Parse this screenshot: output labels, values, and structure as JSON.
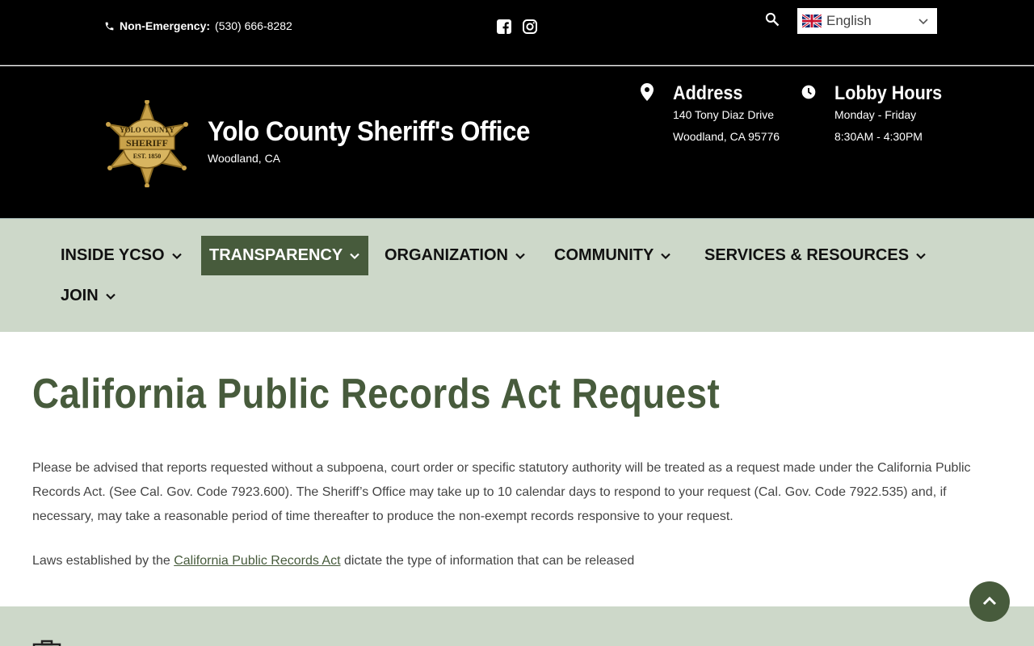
{
  "topbar": {
    "phone_label": "Non-Emergency:",
    "phone_number": "(530) 666-8282",
    "language": "English"
  },
  "header": {
    "title": "Yolo County Sheriff's Office",
    "subtitle": "Woodland, CA",
    "address_title": "Address",
    "address_line1": "140 Tony Diaz Drive",
    "address_line2": "Woodland, CA 95776",
    "hours_title": "Lobby Hours",
    "hours_line1": "Monday - Friday",
    "hours_line2": "8:30AM - 4:30PM",
    "badge_text_top": "YOLO COUNTY",
    "badge_text_mid": "SHERIFF",
    "badge_text_bot": "EST. 1850"
  },
  "nav": {
    "items": [
      {
        "label": "INSIDE YCSO"
      },
      {
        "label": "TRANSPARENCY"
      },
      {
        "label": "ORGANIZATION"
      },
      {
        "label": "COMMUNITY"
      },
      {
        "label": "SERVICES & RESOURCES"
      },
      {
        "label": "JOIN"
      }
    ]
  },
  "main": {
    "title": "California Public Records Act Request",
    "para1": "Please be advised that reports requested without a subpoena, court order or specific statutory authority will be treated as a request made under the California Public Records Act. (See Cal. Gov. Code 7923.600).  The Sheriff’s Office may take up to 10 calendar days to respond to your request (Cal. Gov. Code 7922.535) and, if necessary, may take a reasonable period of time thereafter to produce the non-exempt records responsive to your request.",
    "para2_before": "Laws established by the ",
    "para2_link": "California Public Records Act",
    "para2_after": " dictate the type of information that can be released"
  },
  "colors": {
    "brand_green": "#475b3c",
    "nav_bg": "#cdd8c9",
    "header_bg": "#000000",
    "badge_gold": "#c9a24a"
  },
  "icons": {
    "phone": "phone-icon",
    "facebook": "facebook-icon",
    "instagram": "instagram-icon",
    "search": "search-icon",
    "flag": "uk-flag-icon",
    "location": "map-pin-icon",
    "clock": "clock-icon",
    "chevron": "chevron-down-icon",
    "back_to_top": "chevron-up-icon"
  }
}
